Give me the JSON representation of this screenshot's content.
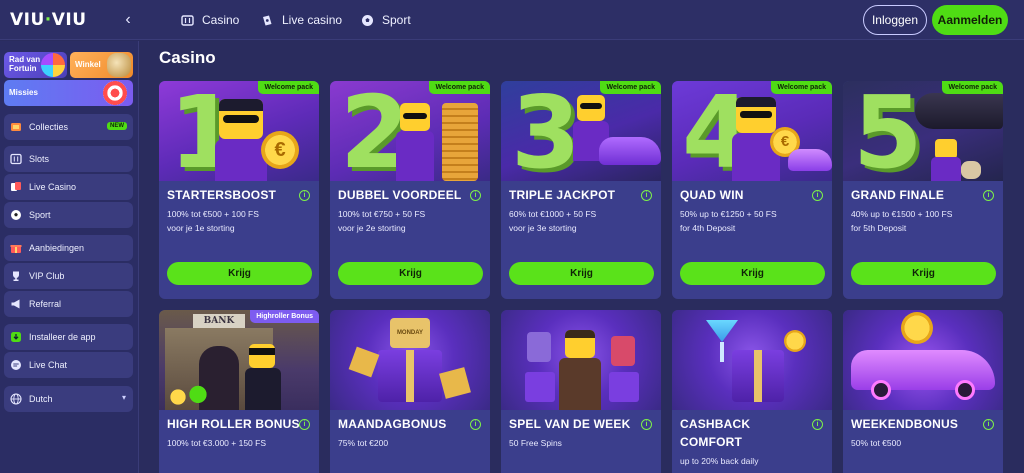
{
  "header": {
    "logo_left": "VIU",
    "logo_sep": "·",
    "logo_right": "VIU",
    "nav": [
      {
        "label": "Casino",
        "icon": "slot-machine-icon"
      },
      {
        "label": "Live casino",
        "icon": "cards-icon"
      },
      {
        "label": "Sport",
        "icon": "soccer-ball-icon"
      }
    ],
    "login_label": "Inloggen",
    "signup_label": "Aanmelden"
  },
  "sidebar": {
    "promos": [
      {
        "label": "Rad van Fortuin"
      },
      {
        "label": "Winkel"
      },
      {
        "label": "Missies"
      }
    ],
    "items": [
      {
        "label": "Collecties",
        "badge": "NEW"
      },
      {
        "label": "Slots"
      },
      {
        "label": "Live Casino"
      },
      {
        "label": "Sport"
      },
      {
        "label": "Aanbiedingen"
      },
      {
        "label": "VIP Club"
      },
      {
        "label": "Referral"
      },
      {
        "label": "Installeer de app"
      },
      {
        "label": "Live Chat"
      },
      {
        "label": "Dutch"
      }
    ]
  },
  "main": {
    "title": "Casino",
    "cards": [
      {
        "badge": "Welcome pack",
        "title": "STARTERSBOOST",
        "line1": "100% tot €500 + 100 FS",
        "line2": "voor je 1e storting",
        "button": "Krijg",
        "numeral": "1"
      },
      {
        "badge": "Welcome pack",
        "title": "DUBBEL VOORDEEL",
        "line1": "100% tot €750 + 50 FS",
        "line2": "voor je 2e storting",
        "button": "Krijg",
        "numeral": "2"
      },
      {
        "badge": "Welcome pack",
        "title": "TRIPLE JACKPOT",
        "line1": "60% tot €1000 + 50 FS",
        "line2": "voor je 3e storting",
        "button": "Krijg",
        "numeral": "3"
      },
      {
        "badge": "Welcome pack",
        "title": "QUAD WIN",
        "line1": "50% up to €1250 + 50 FS",
        "line2": "for 4th Deposit",
        "button": "Krijg",
        "numeral": "4"
      },
      {
        "badge": "Welcome pack",
        "title": "GRAND FINALE",
        "line1": "40% up to €1500 + 100 FS",
        "line2": "for 5th Deposit",
        "button": "Krijg",
        "numeral": "5"
      },
      {
        "badge": "Highroller Bonus",
        "title": "HIGH ROLLER BONUS",
        "line1": "100% tot €3.000 + 150 FS",
        "sign": "BANK"
      },
      {
        "title": "MAANDAGBONUS",
        "line1": "75% tot €200",
        "sign": "MONDAY"
      },
      {
        "title": "SPEL VAN DE WEEK",
        "line1": "50 Free Spins"
      },
      {
        "title": "CASHBACK",
        "title2": "COMFORT",
        "line1": "up to 20% back daily"
      },
      {
        "title": "WEEKENDBONUS",
        "line1": "50% tot €500"
      }
    ]
  },
  "colors": {
    "accent": "#4fdc14",
    "bg": "#2a2c5e",
    "card": "#3b3e8c"
  }
}
